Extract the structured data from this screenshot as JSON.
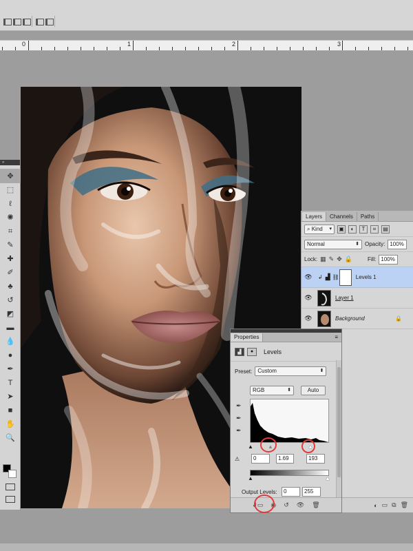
{
  "toolbar": {
    "header": "»",
    "tools": [
      {
        "name": "move-tool",
        "glyph": "✥"
      },
      {
        "name": "marquee-tool",
        "glyph": "⬚"
      },
      {
        "name": "lasso-tool",
        "glyph": "ℓ"
      },
      {
        "name": "quick-select-tool",
        "glyph": "✺"
      },
      {
        "name": "crop-tool",
        "glyph": "⌗"
      },
      {
        "name": "eyedropper-tool",
        "glyph": "✎"
      },
      {
        "name": "healing-brush-tool",
        "glyph": "✚"
      },
      {
        "name": "brush-tool",
        "glyph": "✐"
      },
      {
        "name": "clone-stamp-tool",
        "glyph": "♣"
      },
      {
        "name": "history-brush-tool",
        "glyph": "↺"
      },
      {
        "name": "eraser-tool",
        "glyph": "◩"
      },
      {
        "name": "gradient-tool",
        "glyph": "▬"
      },
      {
        "name": "blur-tool",
        "glyph": "💧"
      },
      {
        "name": "dodge-tool",
        "glyph": "●"
      },
      {
        "name": "pen-tool",
        "glyph": "✒"
      },
      {
        "name": "type-tool",
        "glyph": "T"
      },
      {
        "name": "path-selection-tool",
        "glyph": "➤"
      },
      {
        "name": "shape-tool",
        "glyph": "■"
      },
      {
        "name": "hand-tool",
        "glyph": "✋"
      },
      {
        "name": "zoom-tool",
        "glyph": "🔍"
      }
    ]
  },
  "ruler": {
    "labels": [
      "0",
      "1",
      "2",
      "3"
    ]
  },
  "layers_panel": {
    "tabs": [
      "Layers",
      "Channels",
      "Paths"
    ],
    "filter_kind": "Kind",
    "blend_mode": "Normal",
    "opacity_label": "Opacity:",
    "opacity_value": "100%",
    "lock_label": "Lock:",
    "fill_label": "Fill:",
    "fill_value": "100%",
    "layers": [
      {
        "name": "Levels 1",
        "selected": true
      },
      {
        "name": "Layer 1",
        "selected": false
      },
      {
        "name": "Background",
        "selected": false
      }
    ]
  },
  "properties_panel": {
    "tab": "Properties",
    "title": "Levels",
    "preset_label": "Preset:",
    "preset_value": "Custom",
    "channel_value": "RGB",
    "auto_label": "Auto",
    "input_levels": [
      "0",
      "1.69",
      "193"
    ],
    "output_label": "Output Levels:",
    "output_levels": [
      "0",
      "255"
    ]
  },
  "colors": {
    "highlight_circle": "#e23a3a",
    "selected_layer": "#bcd2f5",
    "panel_bg": "#d6d6d6"
  }
}
